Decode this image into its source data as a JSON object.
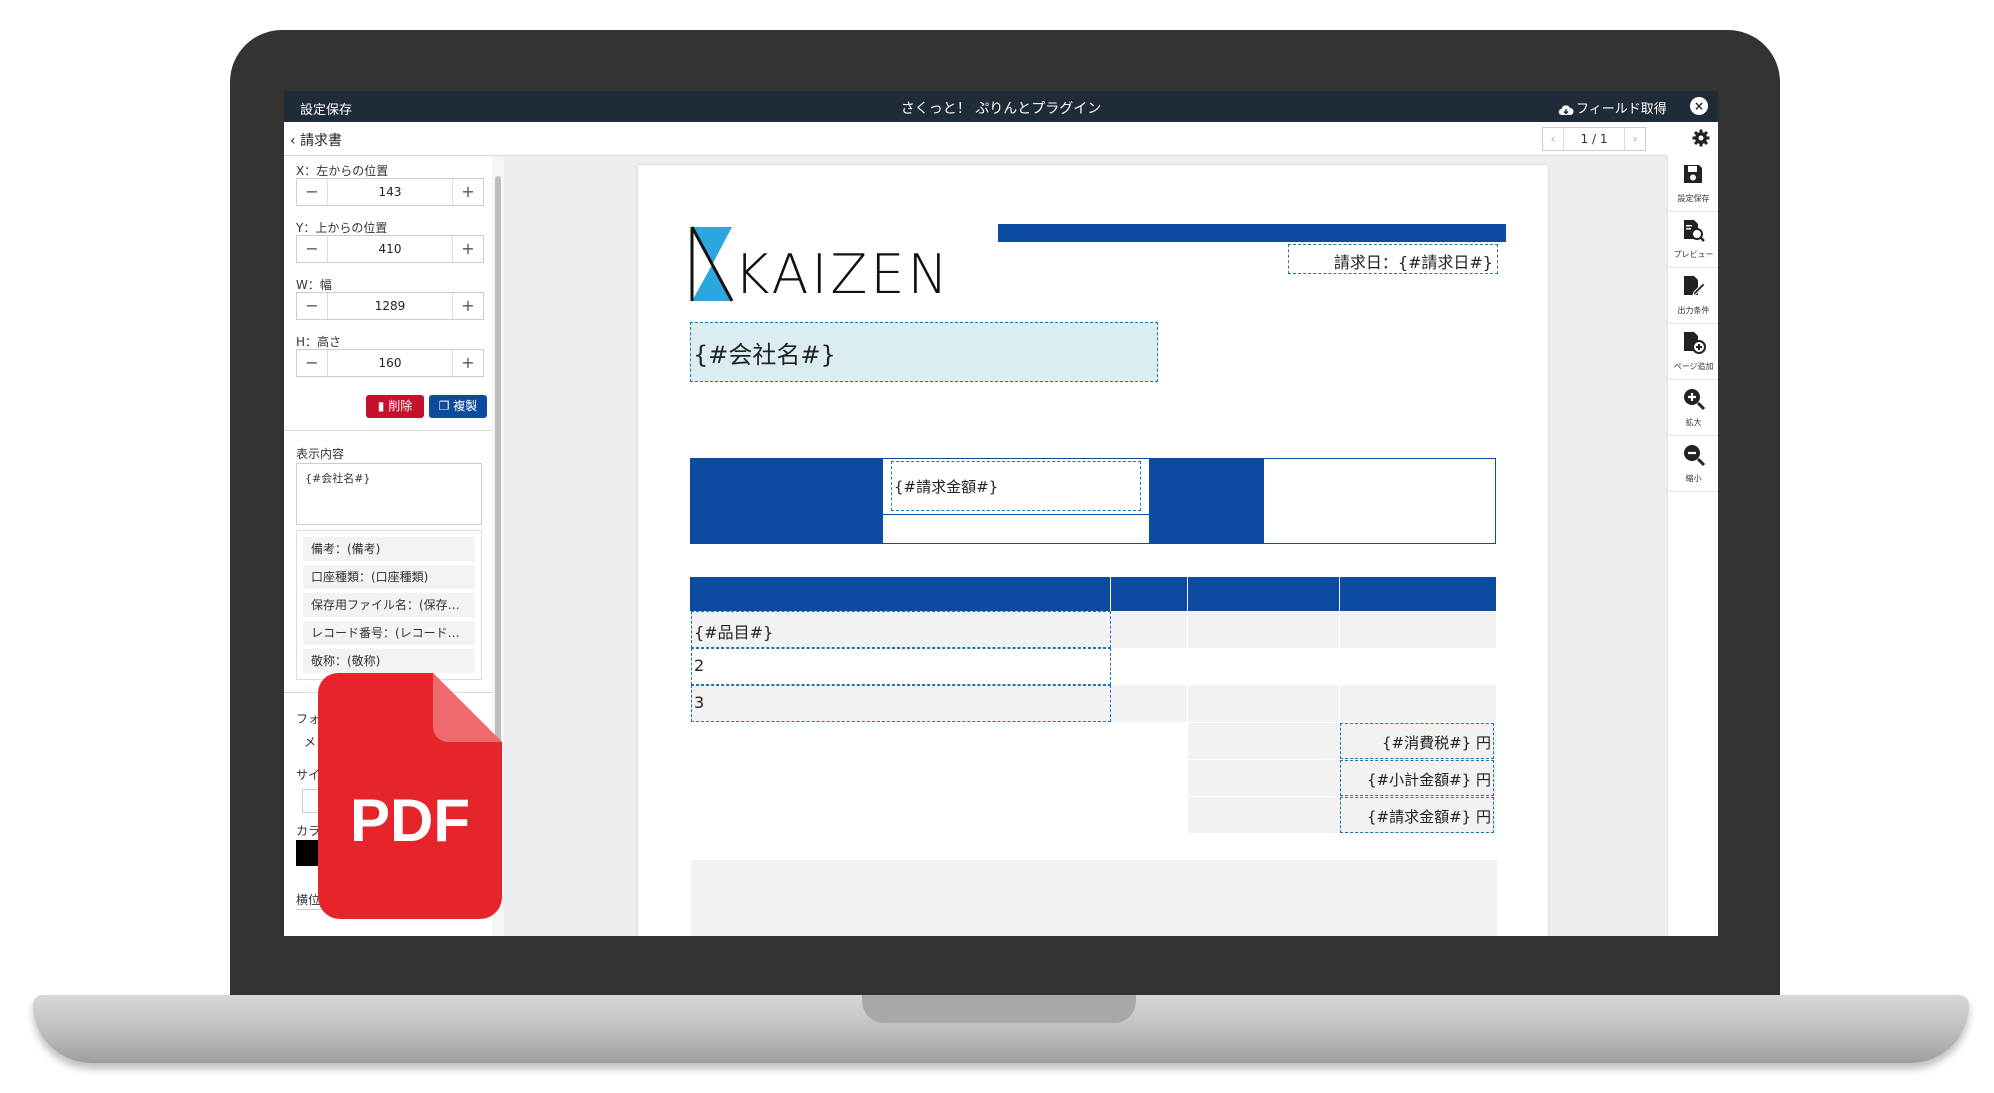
{
  "titlebar": {
    "save": "設定保存",
    "title": "さくっと！ ぷりんとプラグイン",
    "field_get": "フィールド取得",
    "close_icon": "close-icon"
  },
  "header": {
    "back_label": "請求書",
    "pager": "1 / 1"
  },
  "left_panel": {
    "x_label": "X：左からの位置",
    "x_value": "143",
    "y_label": "Y：上からの位置",
    "y_value": "410",
    "w_label": "W：幅",
    "w_value": "1289",
    "h_label": "H：高さ",
    "h_value": "160",
    "delete_label": "削除",
    "copy_label": "複製",
    "content_label": "表示内容",
    "content_value": "{#会社名#}",
    "field_items": [
      "備考：(備考)",
      "口座種類：(口座種類)",
      "保存用ファイル名：(保存…",
      "レコード番号：(レコード…",
      "敬称：(敬称)"
    ],
    "partial_labels": [
      "フォ",
      "メ",
      "サイ",
      "カラ",
      "横位"
    ]
  },
  "pdf_icon": {
    "label": "PDF"
  },
  "toolbar": {
    "save": "設定保存",
    "preview": "プレビュー",
    "output": "出力条件",
    "add_page": "ページ追加",
    "zoom_in": "拡大",
    "zoom_out": "縮小"
  },
  "document": {
    "logo_text": "KAIZEN",
    "invoice_date": "請求日：{#請求日#}",
    "company": "{#会社名#}",
    "amount_field": "{#請求金額#}",
    "items": [
      "{#品目#}",
      "2",
      "3"
    ],
    "tax": "{#消費税#} 円",
    "subtotal": "{#小計金額#} 円",
    "total": "{#請求金額#} 円"
  },
  "colors": {
    "brand_blue": "#0d4ba0",
    "delete_red": "#c8102e",
    "pdf_red": "#e5252a",
    "titlebar": "#1f2b36"
  }
}
